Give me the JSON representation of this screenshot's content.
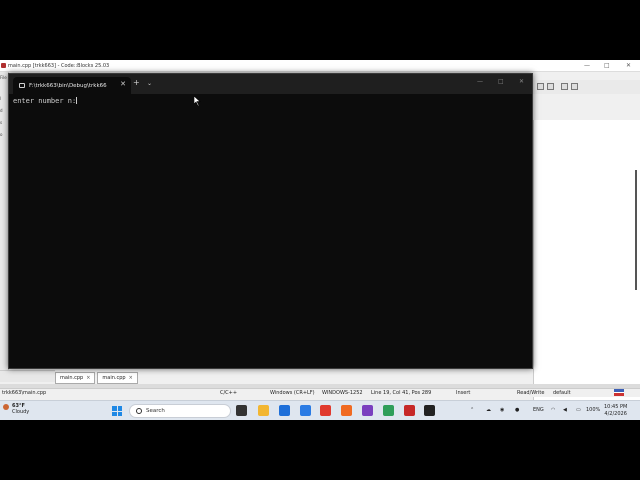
{
  "codeblocks": {
    "title": "main.cpp [trkk663] - Code::Blocks 25.03",
    "left_menu_items": [
      "File",
      "l",
      "d",
      "s",
      "o"
    ],
    "editor_tabs": [
      {
        "label": "main.cpp"
      },
      {
        "label": "main.cpp"
      }
    ],
    "tab_close": "×",
    "statusbar": {
      "file": "trkk663\\main.cpp",
      "language": "C/C++",
      "line_endings": "Windows (CR+LF)",
      "encoding": "WINDOWS-1252",
      "position": "Line 19, Col 41, Pos 289",
      "mode": "Insert",
      "access": "Read/Write",
      "profile": "default"
    },
    "window_controls": {
      "minimize": "—",
      "maximize": "□",
      "close": "✕"
    }
  },
  "terminal": {
    "tab_title": "F:\\trkk663\\bin\\Debug\\trkk66",
    "tab_close": "✕",
    "new_tab": "+",
    "dropdown": "⌄",
    "window_controls": {
      "minimize": "—",
      "maximize": "□",
      "close": "✕"
    },
    "output_line": "enter number n:"
  },
  "taskbar": {
    "weather_temp": "63°F",
    "weather_desc": "Cloudy",
    "search_placeholder": "Search",
    "language": "ENG",
    "battery": "100%",
    "time": "10:45 PM",
    "date": "4/2/2026"
  }
}
